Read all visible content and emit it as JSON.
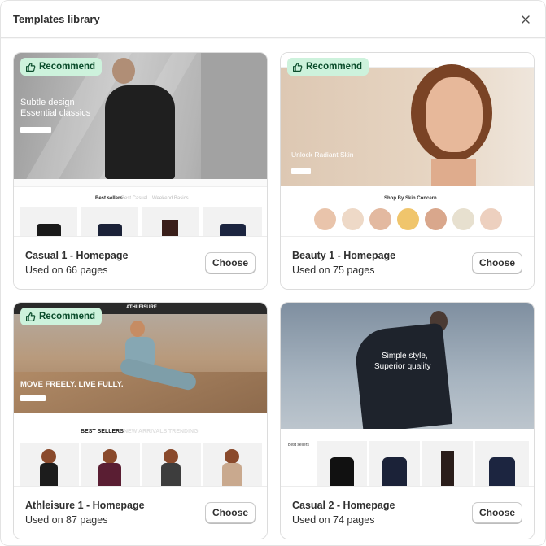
{
  "dialog": {
    "title": "Templates library"
  },
  "badge_label": "Recommend",
  "choose_label": "Choose",
  "templates": [
    {
      "title": "Casual 1 - Homepage",
      "usage": "Used on 66 pages",
      "recommended": true,
      "preview": {
        "hero_line1": "Subtle design",
        "hero_line2": "Essential classics",
        "tabs": [
          "Best sellers",
          "Best Casual",
          "Weekend Basics"
        ]
      }
    },
    {
      "title": "Beauty 1 - Homepage",
      "usage": "Used on 75 pages",
      "recommended": true,
      "preview": {
        "hero_line1": "Unlock Radiant Skin",
        "section_title": "Shop By Skin Concern"
      }
    },
    {
      "title": "Athleisure 1 - Homepage",
      "usage": "Used on 87 pages",
      "recommended": true,
      "preview": {
        "brand": "ATHLEISURE.",
        "hero_line1": "MOVE FREELY. LIVE FULLY.",
        "tabs": [
          "BEST SELLERS",
          "NEW ARRIVALS",
          "TRENDING"
        ]
      }
    },
    {
      "title": "Casual 2 - Homepage",
      "usage": "Used on 74 pages",
      "recommended": false,
      "preview": {
        "hero_line1": "Simple style,",
        "hero_line2": "Superior quality",
        "side_title": "Best sellers"
      }
    }
  ],
  "colors": {
    "badge_bg": "#cdf2dc",
    "badge_text": "#0b4d2c"
  }
}
